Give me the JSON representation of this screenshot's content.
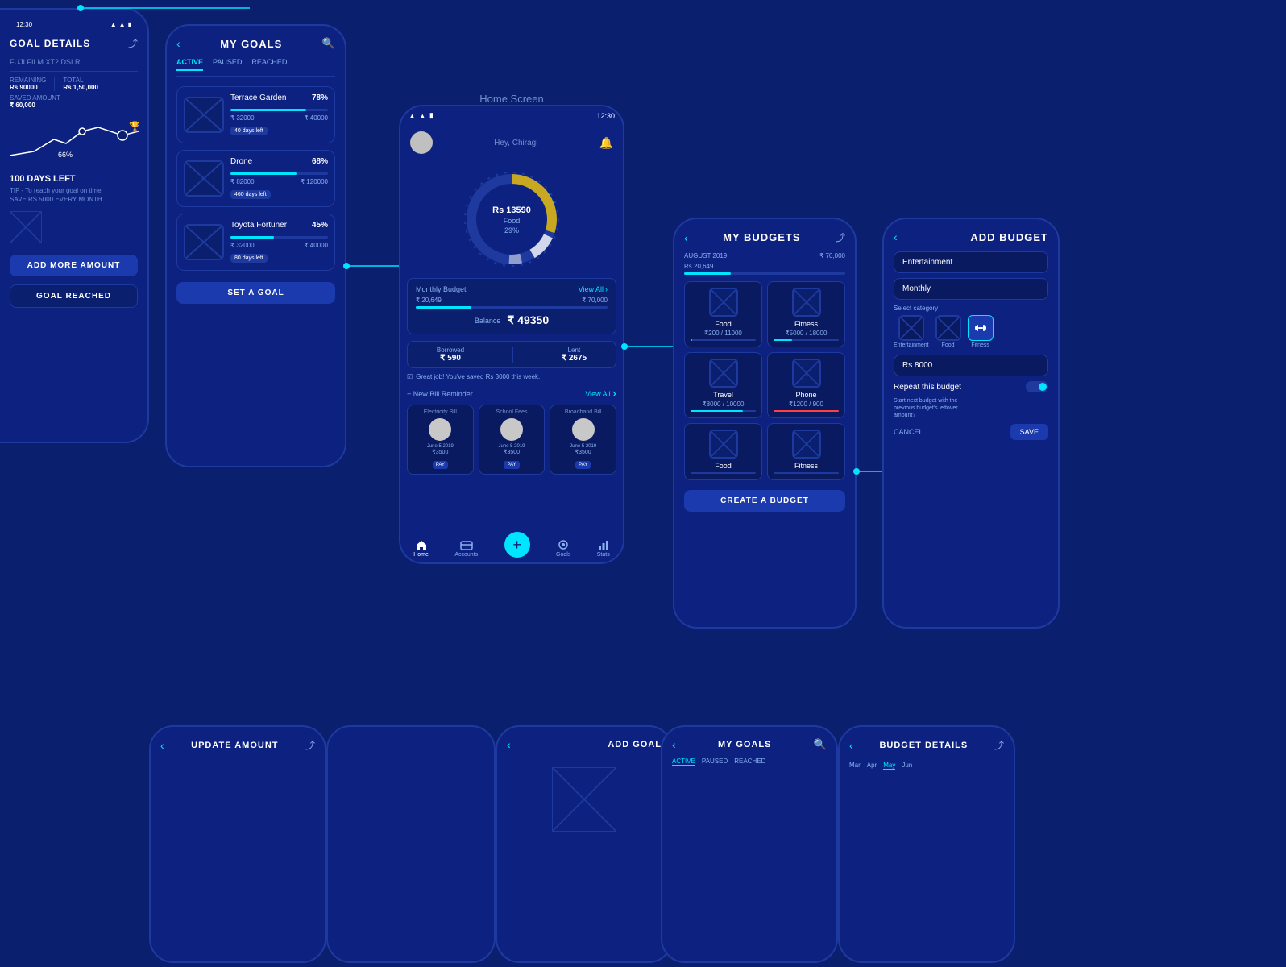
{
  "app": {
    "background": "#0a1f6e",
    "home_screen_label": "Home Screen"
  },
  "goal_details": {
    "title": "GOAL DETAILS",
    "name": "FUJI FILM XT2 DSLR",
    "remaining_label": "REMAINING",
    "remaining": "Rs 90000",
    "total_label": "TOTAL",
    "total": "Rs 1,50,000",
    "saved_label": "SAVED AMOUNT",
    "saved": "₹ 60,000",
    "days_left": "100 DAYS LEFT",
    "pct": "66%",
    "tip": "TIP - To reach your goal on time,",
    "tip2": "SAVE RS 5000 EVERY MONTH",
    "btn_add": "ADD MORE AMOUNT",
    "btn_reached": "GOAL REACHED"
  },
  "my_goals": {
    "title": "MY GOALS",
    "tabs": [
      "ACTIVE",
      "PAUSED",
      "REACHED"
    ],
    "active_tab": "ACTIVE",
    "goals": [
      {
        "name": "Terrace Garden",
        "pct": "78%",
        "min": "₹ 32000",
        "max": "₹ 40000",
        "badge": "40 days left",
        "fill": 78
      },
      {
        "name": "Drone",
        "pct": "68%",
        "min": "₹ 82000",
        "max": "₹ 120000",
        "badge": "460 days left",
        "fill": 68
      },
      {
        "name": "Toyota Fortuner",
        "pct": "45%",
        "min": "₹ 32000",
        "max": "₹ 40000",
        "badge": "80 days left",
        "fill": 45
      }
    ],
    "btn_set_goal": "SET A GOAL"
  },
  "home_screen": {
    "time": "12:30",
    "greeting": "Hey, Chiragi",
    "donut": {
      "amount": "Rs 13590",
      "category": "Food",
      "pct": "29%"
    },
    "monthly_budget_label": "Monthly Budget",
    "view_all": "View All",
    "budget_used": "₹ 20,649",
    "budget_total": "₹ 70,000",
    "balance_label": "Balance",
    "balance": "₹ 49350",
    "borrowed_label": "Borrowed",
    "borrowed": "₹ 590",
    "lent_label": "Lent",
    "lent": "₹ 2675",
    "saved_msg": "Great job! You've saved Rs 3000 this week.",
    "bill_reminder_label": "+ New Bill Reminder",
    "bill_view_all": "View All",
    "bills": [
      {
        "name": "Electricity Bill",
        "date": "June 5 2019",
        "amount": "₹3500",
        "pay": "PAY"
      },
      {
        "name": "School Fees",
        "date": "June 5 2019",
        "amount": "₹3500",
        "pay": "PAY"
      },
      {
        "name": "Broadband Bill",
        "date": "June 5 2019",
        "amount": "₹3500",
        "pay": "PAY"
      }
    ],
    "nav": [
      "Home",
      "Accounts",
      "",
      "Goals",
      "Stats"
    ]
  },
  "my_budgets": {
    "title": "MY BUDGETS",
    "month": "AUGUST 2019",
    "spent": "Rs 20,649",
    "total": "₹ 70,000",
    "cells": [
      {
        "name": "Food",
        "amount": "₹200",
        "limit": "11000",
        "fill": 2
      },
      {
        "name": "Fitness",
        "amount": "₹5000",
        "limit": "18000",
        "fill": 28
      },
      {
        "name": "Travel",
        "amount": "₹8000",
        "limit": "10000",
        "fill": 80
      },
      {
        "name": "Phone",
        "amount": "₹1200",
        "limit": "900",
        "fill": 100
      },
      {
        "name": "Food",
        "amount": "",
        "limit": "",
        "fill": 0
      },
      {
        "name": "Fitness",
        "amount": "",
        "limit": "",
        "fill": 0
      }
    ],
    "btn_create": "CREATE A BUDGET"
  },
  "add_budget": {
    "title": "ADD BUDGET",
    "field_name": "Entertainment",
    "field_period": "Monthly",
    "category_label": "Select category",
    "categories": [
      "Entertainment",
      "Food",
      "Fitness"
    ],
    "field_amount": "Rs 8000",
    "repeat_label": "Repeat this budget",
    "repeat_desc": "Start next budget with the\nprevious budget's leftover\namount?",
    "btn_cancel": "CANCEL",
    "btn_save": "SAVE"
  },
  "update_amount": {
    "title": "UPDATE AMOUNT",
    "back": "<",
    "share": "share"
  },
  "add_goal": {
    "title": "ADD GOAL",
    "back": "<"
  },
  "my_goals_bottom": {
    "title": "MY GOALS",
    "tabs": [
      "ACTIVE",
      "PAUSED",
      "REACHED"
    ]
  },
  "budget_details": {
    "title": "BUDGET DETAILS",
    "back": "<",
    "months": [
      "Mar",
      "Apr",
      "May",
      "Jun"
    ]
  }
}
